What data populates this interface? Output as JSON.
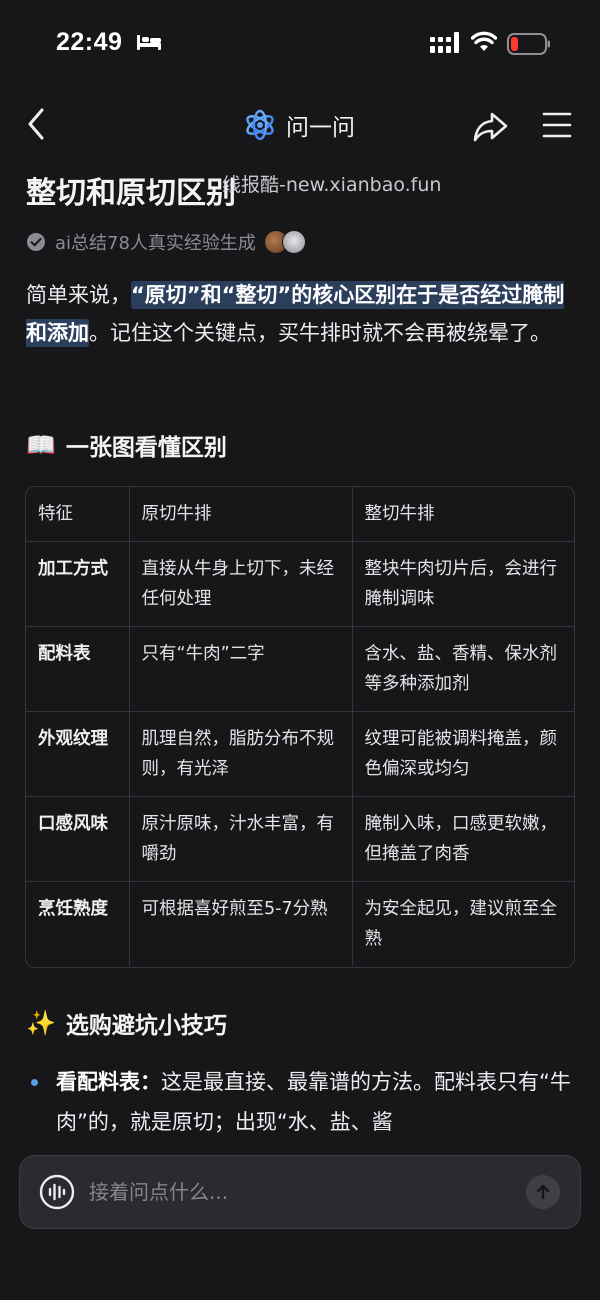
{
  "status_bar": {
    "time": "22:49"
  },
  "nav": {
    "title": "问一问"
  },
  "page": {
    "title": "整切和原切区别",
    "watermark": "线报酷-new.xianbao.fun",
    "source": "ai总结78人真实经验生成"
  },
  "intro": {
    "lead": "简单来说，",
    "highlight": "“原切”和“整切”的核心区别在于是否经过腌制和添加",
    "tail": "。记住这个关键点，买牛排时就不会再被绕晕了。"
  },
  "section1": {
    "emoji": "📖",
    "title": "一张图看懂区别"
  },
  "table": {
    "headers": [
      "特征",
      "原切牛排",
      "整切牛排"
    ],
    "rows": [
      [
        "加工方式",
        "直接从牛身上切下，未经任何处理",
        "整块牛肉切片后，会进行腌制调味"
      ],
      [
        "配料表",
        "只有“牛肉”二字",
        "含水、盐、香精、保水剂等多种添加剂"
      ],
      [
        "外观纹理",
        "肌理自然，脂肪分布不规则，有光泽",
        "纹理可能被调料掩盖，颜色偏深或均匀"
      ],
      [
        "口感风味",
        "原汁原味，汁水丰富，有嚼劲",
        "腌制入味，口感更软嫩，但掩盖了肉香"
      ],
      [
        "烹饪熟度",
        "可根据喜好煎至5-7分熟",
        "为安全起见，建议煎至全熟"
      ]
    ]
  },
  "section2": {
    "emoji": "✨",
    "title": "选购避坑小技巧"
  },
  "tips": [
    {
      "key": "看配料表：",
      "text": "这是最直接、最靠谱的方法。配料表只有“牛肉”的，就是原切；出现“水、盐、酱"
    }
  ],
  "input": {
    "placeholder": "接着问点什么..."
  },
  "colors": {
    "background": "#17171a",
    "highlight": "#2b3f5c",
    "accent": "#5a9de2",
    "battery_low": "#ff3b30"
  }
}
